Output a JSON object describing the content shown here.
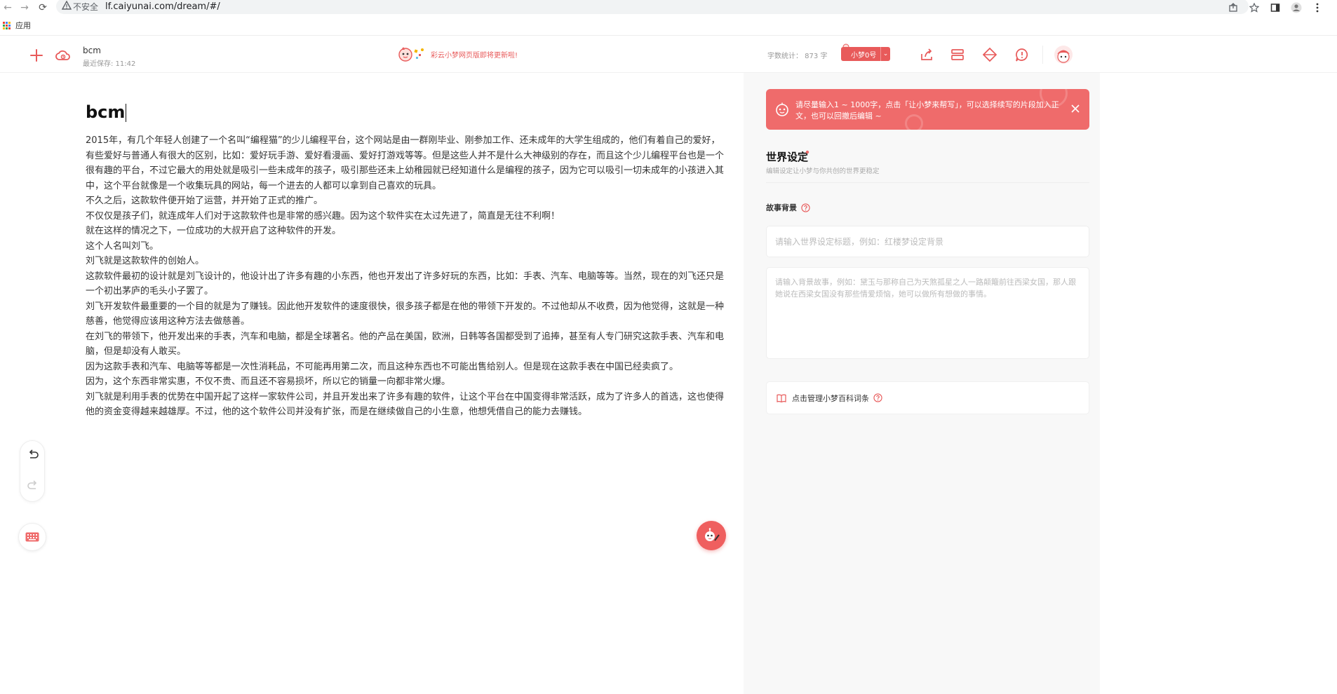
{
  "browser": {
    "insecure_label": "不安全",
    "url": "lf.caiyunai.com/dream/#/",
    "bookmark_apps_label": "应用"
  },
  "header": {
    "doc_title": "bcm",
    "last_saved": "最近保存: 11:42",
    "announcement": "彩云小梦网页版即将更新啦!",
    "word_count": "字数统计： 873 字",
    "model_selector": "小梦0号",
    "brand_color": "#e85a5a"
  },
  "editor": {
    "title": "bcm",
    "paragraphs": [
      "2015年，有几个年轻人创建了一个名叫“编程猫”的少儿编程平台，这个网站是由一群刚毕业、刚参加工作、还未成年的大学生组成的，他们有着自己的爱好，有些爱好与普通人有很大的区别，比如：爱好玩手游、爱好看漫画、爱好打游戏等等。但是这些人并不是什么大神级别的存在，而且这个少儿编程平台也是一个很有趣的平台，不过它最大的用处就是吸引一些未成年的孩子，吸引那些还未上幼稚园就已经知道什么是编程的孩子，因为它可以吸引一切未成年的小孩进入其中，这个平台就像是一个收集玩具的网站，每一个进去的人都可以拿到自己喜欢的玩具。",
      "不久之后，这款软件便开始了运营，并开始了正式的推广。",
      "不仅仅是孩子们，就连成年人们对于这款软件也是非常的感兴趣。因为这个软件实在太过先进了，简直是无往不利啊！",
      "就在这样的情况之下，一位成功的大叔开启了这种软件的开发。",
      "这个人名叫刘飞。",
      "刘飞就是这款软件的创始人。",
      "这款软件最初的设计就是刘飞设计的，他设计出了许多有趣的小东西，他也开发出了许多好玩的东西，比如：手表、汽车、电脑等等。当然，现在的刘飞还只是一个初出茅庐的毛头小子罢了。",
      "刘飞开发软件最重要的一个目的就是为了赚钱。因此他开发软件的速度很快，很多孩子都是在他的带领下开发的。不过他却从不收费，因为他觉得，这就是一种慈善，他觉得应该用这种方法去做慈善。",
      "在刘飞的带领下，他开发出来的手表，汽车和电脑，都是全球著名。他的产品在美国，欧洲，日韩等各国都受到了追捧，甚至有人专门研究这款手表、汽车和电脑，但是却没有人敢买。",
      "因为这款手表和汽车、电脑等等都是一次性消耗品，不可能再用第二次，而且这种东西也不可能出售给别人。但是现在这款手表在中国已经卖疯了。",
      "因为，这个东西非常实惠，不仅不贵、而且还不容易损坏，所以它的销量一向都非常火爆。",
      "刘飞就是利用手表的优势在中国开起了这样一家软件公司，并且开发出来了许多有趣的软件，让这个平台在中国变得非常活跃，成为了许多人的首选，这也使得他的资金变得越来越雄厚。不过，他的这个软件公司并没有扩张，而是在继续做自己的小生意，他想凭借自己的能力去赚钱。"
    ]
  },
  "panel": {
    "banner_text": "请尽量输入1 ~ 1000字，点击「让小梦来帮写」，可以选择续写的片段加入正文，也可以回撤后编辑 ~",
    "world_title": "世界设定",
    "world_subtitle": "编辑设定让小梦与你共创的世界更稳定",
    "background_label": "故事背景",
    "title_placeholder": "请输入世界设定标题，例如：红楼梦设定背景",
    "story_placeholder": "请输入背景故事，例如：黛玉与那称自己为天煞孤星之人一路颠簸前往西梁女国，那人跟她说在西梁女国没有那些情爱烦恼，她可以做所有想做的事情。",
    "wiki_label": "点击管理小梦百科词条"
  }
}
